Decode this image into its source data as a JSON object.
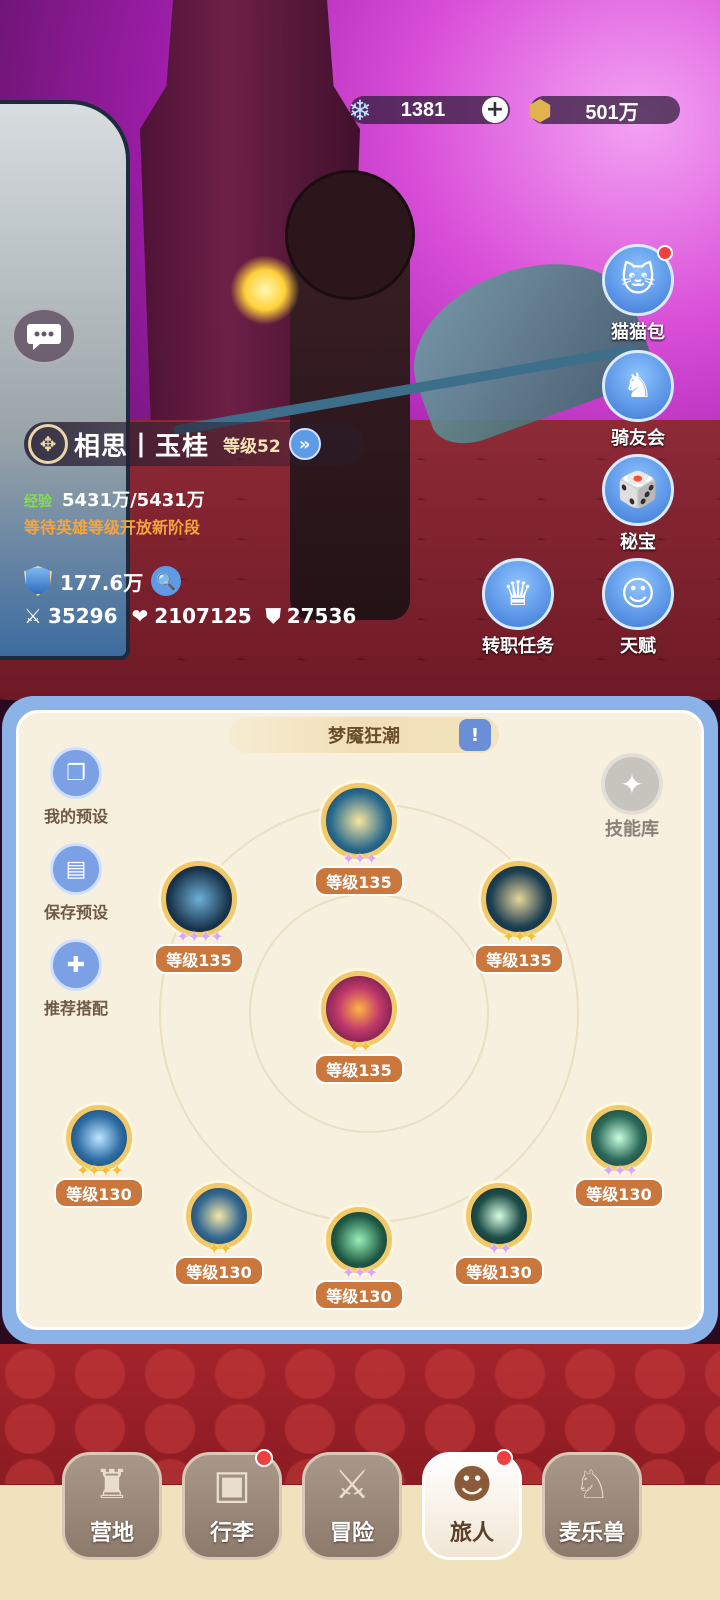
{
  "resources": {
    "crystal": {
      "icon": "crystal-icon",
      "value": "1381",
      "plus": "+"
    },
    "gold": {
      "icon": "gold-coin-icon",
      "value": "501万"
    }
  },
  "character": {
    "name": "相思丨玉桂",
    "level": "等级52",
    "exp_label": "经验",
    "exp_value": "5431万/5431万",
    "hint": "等待英雄等级开放新阶段",
    "power": "177.6万",
    "stats": {
      "attack": "35296",
      "hp": "2107125",
      "defense": "27536"
    }
  },
  "side_menu": [
    {
      "label": "猫猫包",
      "icon": "cat-bag-icon",
      "badge": true
    },
    {
      "label": "骑友会",
      "icon": "horse-icon",
      "badge": false
    },
    {
      "label": "秘宝",
      "icon": "treasure-icon",
      "badge": false
    },
    {
      "label": "天赋",
      "icon": "talent-head-icon",
      "badge": false
    },
    {
      "label": "转职任务",
      "icon": "crown-icon",
      "badge": false
    }
  ],
  "panel": {
    "title": "梦魇狂潮",
    "presets": [
      {
        "label": "我的预设",
        "icon": "preset-cards-icon"
      },
      {
        "label": "保存预设",
        "icon": "save-icon"
      },
      {
        "label": "推荐搭配",
        "icon": "gamepad-icon"
      }
    ],
    "library_label": "技能库"
  },
  "skills": [
    {
      "level": "等级135",
      "stars": 3,
      "star_type": "purple",
      "color": "#2a6a8e"
    },
    {
      "level": "等级135",
      "stars": 4,
      "star_type": "purple",
      "color": "#17324a"
    },
    {
      "level": "等级135",
      "stars": 3,
      "star_type": "gold",
      "color": "#1d3f52"
    },
    {
      "level": "等级135",
      "stars": 2,
      "star_type": "gold",
      "color": "#7a1f58"
    },
    {
      "level": "等级130",
      "stars": 4,
      "star_type": "gold",
      "color": "#2f6fa6"
    },
    {
      "level": "等级130",
      "stars": 2,
      "star_type": "gold",
      "color": "#356a92"
    },
    {
      "level": "等级130",
      "stars": 3,
      "star_type": "purple",
      "color": "#1f5a45"
    },
    {
      "level": "等级130",
      "stars": 2,
      "star_type": "purple",
      "color": "#1f4f4a"
    },
    {
      "level": "等级130",
      "stars": 3,
      "star_type": "purple",
      "color": "#2d6b5a"
    }
  ],
  "nav": [
    {
      "label": "营地",
      "icon": "castle-icon",
      "badge": false,
      "active": false
    },
    {
      "label": "行李",
      "icon": "chest-icon",
      "badge": true,
      "active": false
    },
    {
      "label": "冒险",
      "icon": "crossed-swords-icon",
      "badge": false,
      "active": false
    },
    {
      "label": "旅人",
      "icon": "traveler-icon",
      "badge": true,
      "active": true
    },
    {
      "label": "麦乐兽",
      "icon": "fox-icon",
      "badge": false,
      "active": false
    }
  ]
}
